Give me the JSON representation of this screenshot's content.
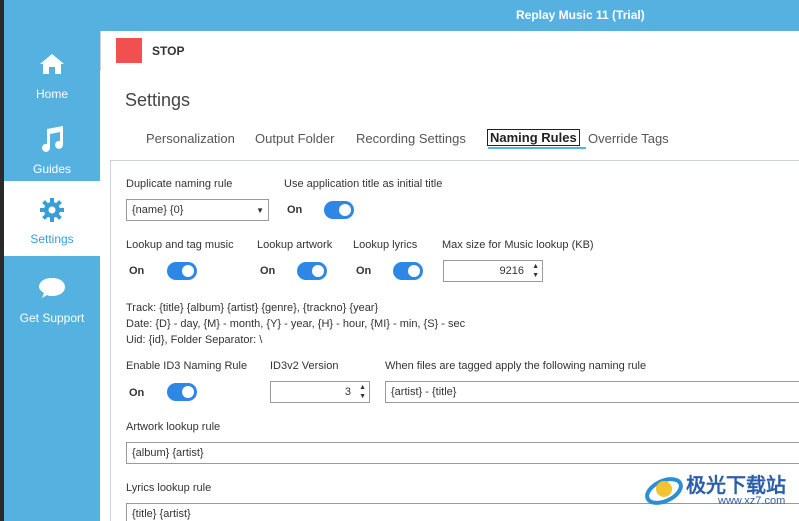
{
  "window": {
    "title": "Replay Music 11 (Trial)"
  },
  "sidebar": {
    "items": [
      {
        "label": "Home",
        "icon": "home-icon"
      },
      {
        "label": "Guides",
        "icon": "music-note-icon"
      },
      {
        "label": "Settings",
        "icon": "gear-icon",
        "active": true
      },
      {
        "label": "Get Support",
        "icon": "speech-bubble-icon"
      }
    ]
  },
  "toolbar": {
    "stop_label": "STOP",
    "stop_color": "#f25050"
  },
  "page": {
    "title": "Settings"
  },
  "tabs": [
    {
      "label": "Personalization"
    },
    {
      "label": "Output Folder"
    },
    {
      "label": "Recording Settings"
    },
    {
      "label": "Naming Rules",
      "active": true
    },
    {
      "label": "Override Tags"
    }
  ],
  "form": {
    "duplicate_naming": {
      "label": "Duplicate naming rule",
      "value": "{name} {0}"
    },
    "use_app_title": {
      "label": "Use application title as initial title",
      "state": "On"
    },
    "lookup_tag_music": {
      "label": "Lookup and tag music",
      "state": "On"
    },
    "lookup_artwork": {
      "label": "Lookup artwork",
      "state": "On"
    },
    "lookup_lyrics": {
      "label": "Lookup lyrics",
      "state": "On"
    },
    "max_size": {
      "label": "Max size for Music lookup (KB)",
      "value": "9216"
    },
    "info_lines": [
      "Track: {title} {album} {artist} {genre}, {trackno} {year}",
      "Date: {D} - day, {M} - month, {Y} - year, {H} - hour, {MI} - min, {S} - sec",
      "Uid: {id}, Folder Separator: \\"
    ],
    "enable_id3": {
      "label": "Enable ID3 Naming Rule",
      "state": "On"
    },
    "id3v2_version": {
      "label": "ID3v2 Version",
      "value": "3"
    },
    "tagged_rule": {
      "label": "When files are tagged apply the following naming rule",
      "value": "{artist} - {title}"
    },
    "artwork_rule": {
      "label": "Artwork lookup rule",
      "value": "{album} {artist}"
    },
    "lyrics_rule": {
      "label": "Lyrics lookup rule",
      "value": "{title} {artist}"
    }
  },
  "watermark": {
    "text": "极光下载站",
    "url": "www.xz7.com"
  },
  "colors": {
    "accent": "#55b2e0",
    "toggle_on": "#2f87e5"
  }
}
